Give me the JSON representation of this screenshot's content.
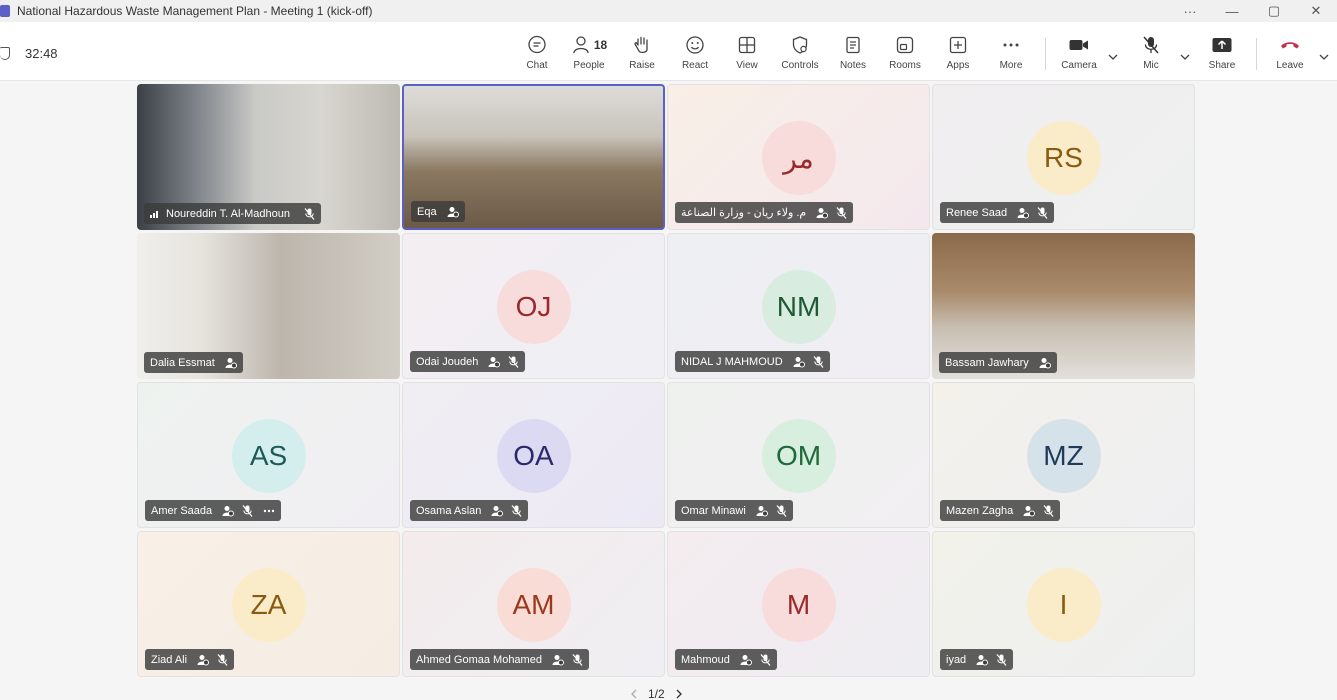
{
  "window": {
    "title": "National Hazardous Waste Management Plan - Meeting 1 (kick-off)",
    "controls": [
      "···",
      "—",
      "▢",
      "✕"
    ]
  },
  "toolbar": {
    "timer": "32:48",
    "chat": "Chat",
    "people": "People",
    "people_count": "18",
    "raise": "Raise",
    "react": "React",
    "view": "View",
    "controls": "Controls",
    "notes": "Notes",
    "rooms": "Rooms",
    "apps": "Apps",
    "more": "More",
    "camera": "Camera",
    "mic": "Mic",
    "share": "Share",
    "leave": "Leave",
    "leave_color": "#c4314b"
  },
  "participants": [
    {
      "name": "Noureddin T. Al-Madhoun",
      "initials": "",
      "video": true
    },
    {
      "name": "Eqa",
      "initials": "",
      "video": true
    },
    {
      "name": "م. ولاء ريان - وزارة الصناعة",
      "initials": "مر",
      "video": false,
      "avatar_bg": "#f8dcdc",
      "avatar_fg": "#9a2a2a"
    },
    {
      "name": "Renee Saad",
      "initials": "RS",
      "video": false,
      "avatar_bg": "#fbecc9",
      "avatar_fg": "#8a5a10"
    },
    {
      "name": "Dalia Essmat",
      "initials": "",
      "video": true
    },
    {
      "name": "Odai Joudeh",
      "initials": "OJ",
      "video": false,
      "avatar_bg": "#f8dcdc",
      "avatar_fg": "#9a2a2a"
    },
    {
      "name": "NIDAL J MAHMOUD",
      "initials": "NM",
      "video": false,
      "avatar_bg": "#d8ecdf",
      "avatar_fg": "#1f5a36"
    },
    {
      "name": "Bassam Jawhary",
      "initials": "",
      "video": true
    },
    {
      "name": "Amer Saada",
      "initials": "AS",
      "video": false,
      "avatar_bg": "#d4eeee",
      "avatar_fg": "#1f5a5a"
    },
    {
      "name": "Osama Aslan",
      "initials": "OA",
      "video": false,
      "avatar_bg": "#dcdaf2",
      "avatar_fg": "#2a2a6a"
    },
    {
      "name": "Omar Minawi",
      "initials": "OM",
      "video": false,
      "avatar_bg": "#d8efe0",
      "avatar_fg": "#1f6a3a"
    },
    {
      "name": "Mazen Zagha",
      "initials": "MZ",
      "video": false,
      "avatar_bg": "#d6e2ea",
      "avatar_fg": "#1f3a5a"
    },
    {
      "name": "Ziad Ali",
      "initials": "ZA",
      "video": false,
      "avatar_bg": "#fbecc9",
      "avatar_fg": "#8a5a10"
    },
    {
      "name": "Ahmed Gomaa Mohamed",
      "initials": "AM",
      "video": false,
      "avatar_bg": "#fadcd6",
      "avatar_fg": "#9a3a1a"
    },
    {
      "name": "Mahmoud",
      "initials": "M",
      "video": false,
      "avatar_bg": "#f8dcdc",
      "avatar_fg": "#9a2a2a"
    },
    {
      "name": "iyad",
      "initials": "I",
      "video": false,
      "avatar_bg": "#fbecc9",
      "avatar_fg": "#8a5a10"
    }
  ],
  "pager": {
    "text": "1/2"
  },
  "colors": {
    "accent": "#5b5fc7"
  }
}
